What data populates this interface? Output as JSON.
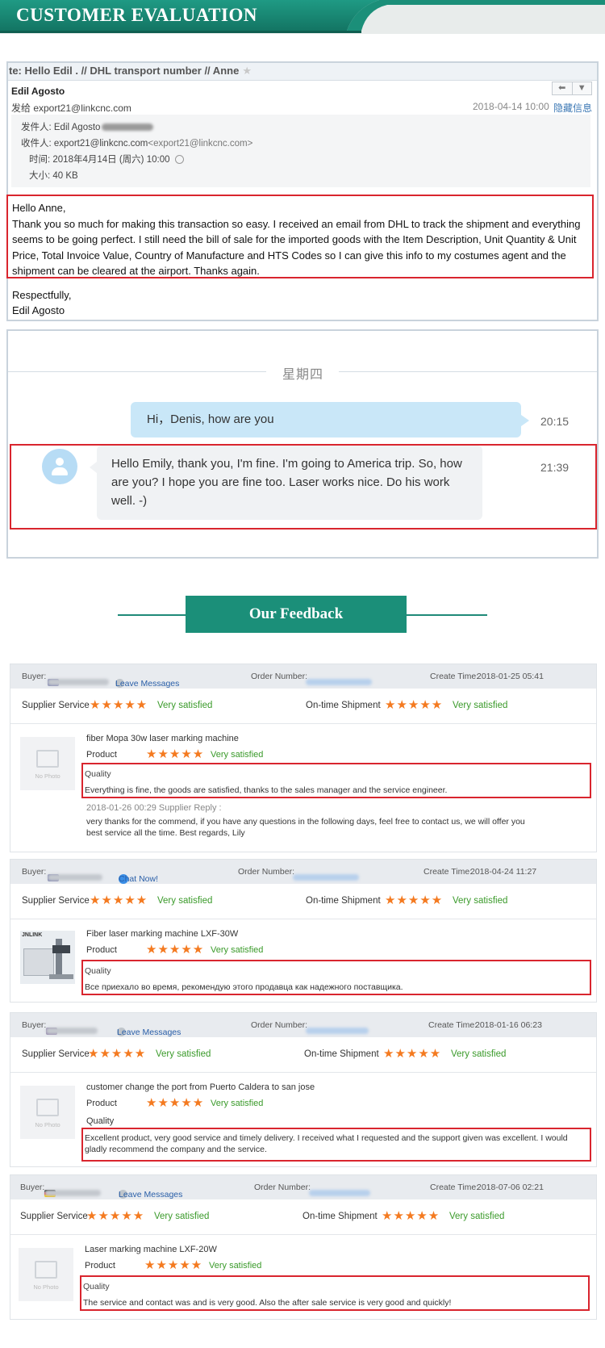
{
  "banner": {
    "title": "CUSTOMER EVALUATION",
    "color": "#1b8f79"
  },
  "email": {
    "subject": "te: Hello Edil . // DHL  transport number  // Anne",
    "star_icon": "star-icon",
    "from_name": "Edil Agosto",
    "send_to": "发给 export21@linkcnc.com",
    "date": "2018-04-14 10:00",
    "hide_info": "隐藏信息",
    "reply_icon": "reply-arrow-icon",
    "dropdown_icon": "chevron-down-icon",
    "sender_label": "发件人: Edil Agosto",
    "receiver_label": "收件人: export21@linkcnc.com",
    "receiver_addr": "<export21@linkcnc.com>",
    "time_label": "时间: 2018年4月14日 (周六) 10:00",
    "size_label": "大小: 40 KB",
    "greeting": "Hello Anne,",
    "body": "Thank you so much for making this transaction so easy. I received an email from DHL to track the shipment and everything seems to be going perfect. I still need the bill of sale for the imported goods with the Item Description, Unit Quantity & Unit Price, Total Invoice Value, Country of Manufacture and HTS Codes so I can give this info to my costumes agent and the shipment can be cleared at the airport. Thanks again.",
    "sign_off": "Respectfully,",
    "sign_name": "Edil Agosto"
  },
  "chat": {
    "day": "星期四",
    "outgoing": "Hi，Denis, how are you",
    "outgoing_time": "20:15",
    "incoming": "Hello Emily, thank you, I'm fine. I'm going to America trip. So, how are you? I hope you are fine too. Laser works nice. Do his work well. -)",
    "incoming_time": "21:39"
  },
  "feedback_heading": "Our Feedback",
  "labels": {
    "buyer": "Buyer:",
    "order_number": "Order Number:",
    "create_time": "Create Time:",
    "supplier_service": "Supplier Service",
    "ontime_shipment": "On-time Shipment",
    "very_satisfied": "Very satisfied",
    "product": "Product",
    "quality": "Quality",
    "no_photo": "No Photo",
    "stars": "★★★★★"
  },
  "reviews": [
    {
      "contact": "Leave Messages",
      "create_time": "2018-01-25 05:41",
      "product": "fiber Mopa 30w laser marking machine",
      "quality_text": "Everything is fine, the goods are satisfied, thanks to the sales manager and the service engineer.",
      "reply_header": "2018-01-26 00:29  Supplier Reply :",
      "reply_text": "very thanks for the commend, if you have any questions in the following days, feel free to contact us, we will offer you best service all the time. Best regards, Lily",
      "rating": 5
    },
    {
      "contact": "Chat Now!",
      "create_time": "2018-04-24 11:27",
      "product": "Fiber laser marking machine LXF-30W",
      "quality_text": "Все приехало во время, рекомендую этого продавца как надежного поставщика.",
      "thumb_logo": "JNLINK",
      "rating": 5
    },
    {
      "contact": "Leave Messages",
      "create_time": "2018-01-16 06:23",
      "product": "customer change the port from Puerto Caldera to san jose",
      "quality_text": "Excellent product, very good service and timely delivery. I received what I requested and the support given was excellent. I would gladly recommend the company and the service.",
      "rating": 5
    },
    {
      "contact": "Leave Messages",
      "create_time": "2018-07-06 02:21",
      "product": "Laser marking machine LXF-20W",
      "quality_text": "The service and contact was and is very good. Also the after sale service is very good and quickly!",
      "rating": 5
    }
  ]
}
